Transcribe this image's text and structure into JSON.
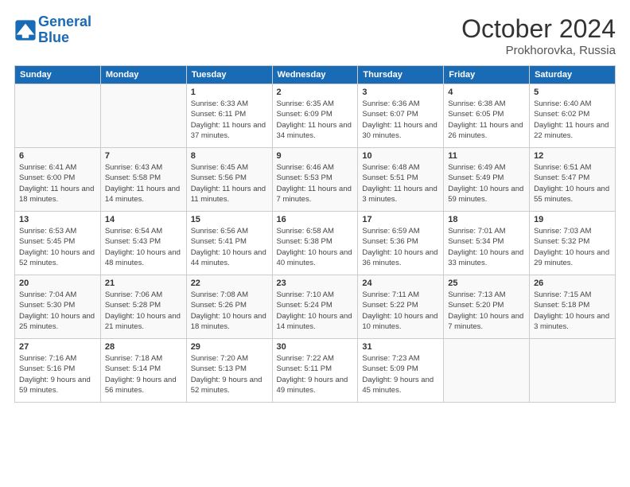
{
  "header": {
    "logo_line1": "General",
    "logo_line2": "Blue",
    "month": "October 2024",
    "location": "Prokhorovka, Russia"
  },
  "weekdays": [
    "Sunday",
    "Monday",
    "Tuesday",
    "Wednesday",
    "Thursday",
    "Friday",
    "Saturday"
  ],
  "weeks": [
    [
      {
        "day": "",
        "info": ""
      },
      {
        "day": "",
        "info": ""
      },
      {
        "day": "1",
        "info": "Sunrise: 6:33 AM\nSunset: 6:11 PM\nDaylight: 11 hours and 37 minutes."
      },
      {
        "day": "2",
        "info": "Sunrise: 6:35 AM\nSunset: 6:09 PM\nDaylight: 11 hours and 34 minutes."
      },
      {
        "day": "3",
        "info": "Sunrise: 6:36 AM\nSunset: 6:07 PM\nDaylight: 11 hours and 30 minutes."
      },
      {
        "day": "4",
        "info": "Sunrise: 6:38 AM\nSunset: 6:05 PM\nDaylight: 11 hours and 26 minutes."
      },
      {
        "day": "5",
        "info": "Sunrise: 6:40 AM\nSunset: 6:02 PM\nDaylight: 11 hours and 22 minutes."
      }
    ],
    [
      {
        "day": "6",
        "info": "Sunrise: 6:41 AM\nSunset: 6:00 PM\nDaylight: 11 hours and 18 minutes."
      },
      {
        "day": "7",
        "info": "Sunrise: 6:43 AM\nSunset: 5:58 PM\nDaylight: 11 hours and 14 minutes."
      },
      {
        "day": "8",
        "info": "Sunrise: 6:45 AM\nSunset: 5:56 PM\nDaylight: 11 hours and 11 minutes."
      },
      {
        "day": "9",
        "info": "Sunrise: 6:46 AM\nSunset: 5:53 PM\nDaylight: 11 hours and 7 minutes."
      },
      {
        "day": "10",
        "info": "Sunrise: 6:48 AM\nSunset: 5:51 PM\nDaylight: 11 hours and 3 minutes."
      },
      {
        "day": "11",
        "info": "Sunrise: 6:49 AM\nSunset: 5:49 PM\nDaylight: 10 hours and 59 minutes."
      },
      {
        "day": "12",
        "info": "Sunrise: 6:51 AM\nSunset: 5:47 PM\nDaylight: 10 hours and 55 minutes."
      }
    ],
    [
      {
        "day": "13",
        "info": "Sunrise: 6:53 AM\nSunset: 5:45 PM\nDaylight: 10 hours and 52 minutes."
      },
      {
        "day": "14",
        "info": "Sunrise: 6:54 AM\nSunset: 5:43 PM\nDaylight: 10 hours and 48 minutes."
      },
      {
        "day": "15",
        "info": "Sunrise: 6:56 AM\nSunset: 5:41 PM\nDaylight: 10 hours and 44 minutes."
      },
      {
        "day": "16",
        "info": "Sunrise: 6:58 AM\nSunset: 5:38 PM\nDaylight: 10 hours and 40 minutes."
      },
      {
        "day": "17",
        "info": "Sunrise: 6:59 AM\nSunset: 5:36 PM\nDaylight: 10 hours and 36 minutes."
      },
      {
        "day": "18",
        "info": "Sunrise: 7:01 AM\nSunset: 5:34 PM\nDaylight: 10 hours and 33 minutes."
      },
      {
        "day": "19",
        "info": "Sunrise: 7:03 AM\nSunset: 5:32 PM\nDaylight: 10 hours and 29 minutes."
      }
    ],
    [
      {
        "day": "20",
        "info": "Sunrise: 7:04 AM\nSunset: 5:30 PM\nDaylight: 10 hours and 25 minutes."
      },
      {
        "day": "21",
        "info": "Sunrise: 7:06 AM\nSunset: 5:28 PM\nDaylight: 10 hours and 21 minutes."
      },
      {
        "day": "22",
        "info": "Sunrise: 7:08 AM\nSunset: 5:26 PM\nDaylight: 10 hours and 18 minutes."
      },
      {
        "day": "23",
        "info": "Sunrise: 7:10 AM\nSunset: 5:24 PM\nDaylight: 10 hours and 14 minutes."
      },
      {
        "day": "24",
        "info": "Sunrise: 7:11 AM\nSunset: 5:22 PM\nDaylight: 10 hours and 10 minutes."
      },
      {
        "day": "25",
        "info": "Sunrise: 7:13 AM\nSunset: 5:20 PM\nDaylight: 10 hours and 7 minutes."
      },
      {
        "day": "26",
        "info": "Sunrise: 7:15 AM\nSunset: 5:18 PM\nDaylight: 10 hours and 3 minutes."
      }
    ],
    [
      {
        "day": "27",
        "info": "Sunrise: 7:16 AM\nSunset: 5:16 PM\nDaylight: 9 hours and 59 minutes."
      },
      {
        "day": "28",
        "info": "Sunrise: 7:18 AM\nSunset: 5:14 PM\nDaylight: 9 hours and 56 minutes."
      },
      {
        "day": "29",
        "info": "Sunrise: 7:20 AM\nSunset: 5:13 PM\nDaylight: 9 hours and 52 minutes."
      },
      {
        "day": "30",
        "info": "Sunrise: 7:22 AM\nSunset: 5:11 PM\nDaylight: 9 hours and 49 minutes."
      },
      {
        "day": "31",
        "info": "Sunrise: 7:23 AM\nSunset: 5:09 PM\nDaylight: 9 hours and 45 minutes."
      },
      {
        "day": "",
        "info": ""
      },
      {
        "day": "",
        "info": ""
      }
    ]
  ]
}
